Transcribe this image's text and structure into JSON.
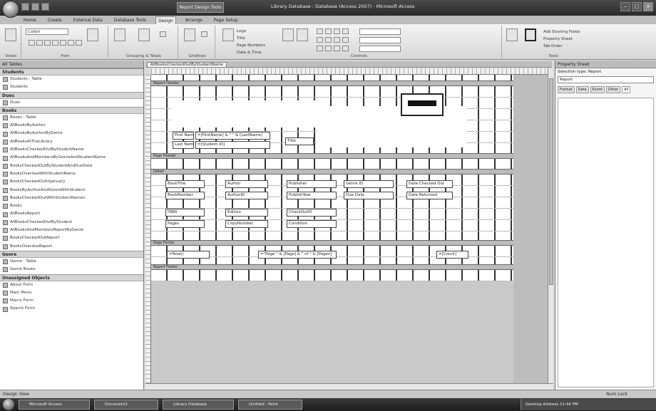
{
  "titlebar": {
    "tool_tab": "Report Design Tools",
    "window_title": "Library Database : Database (Access 2007) - Microsoft Access"
  },
  "ribbon_tabs": [
    "Home",
    "Create",
    "External Data",
    "Database Tools",
    "Design",
    "Arrange",
    "Page Setup"
  ],
  "ribbon": {
    "group_labels": [
      "Views",
      "Font",
      "Grouping & Totals",
      "Gridlines",
      "Controls",
      "Tools"
    ],
    "font_name": "Calibri",
    "controls_text": [
      "Logo",
      "Title",
      "Page Numbers",
      "Date & Time"
    ],
    "tools_text": [
      "Add Existing Fields",
      "Property Sheet",
      "Tab Order"
    ]
  },
  "nav": {
    "header": "All Tables",
    "sections": [
      {
        "title": "Students",
        "items": [
          "Students : Table",
          "Students"
        ]
      },
      {
        "title": "Dues",
        "items": [
          "Dues"
        ]
      },
      {
        "title": "Books",
        "items": [
          "Books : Table",
          "AllBooksByAuthor",
          "AllBooksByAuthorByGenre",
          "AllBooksAtTheLibrary",
          "AllBooksCheckedOutByStudentName",
          "AllBooksAndMembersByGenreAndStudentName",
          "BooksCheckedOutByStudentAndDueDate",
          "BooksOverdueWithStudentName",
          "BooksCheckedOutInJanuary",
          "BooksByAuthorAndGenreWithStudent",
          "BooksCheckedOutWithStudentNames",
          "Books",
          "AllBooksReport",
          "AllBooksCheckedOutByStudent",
          "AllBooksAndMembersReportByGenre",
          "BooksCheckedOutReport",
          "BooksOverdueReport"
        ]
      },
      {
        "title": "Genre",
        "items": [
          "Genre : Table",
          "Genre Books"
        ]
      },
      {
        "title": "Unassigned Objects",
        "items": [
          "About Form",
          "Main Menu",
          "Macro Form",
          "Search Form"
        ]
      }
    ]
  },
  "doc": {
    "tab_label": "AllBooksCheckedOutByStudentName",
    "sections": [
      "Report Header",
      "Page Header",
      "Detail",
      "Page Footer",
      "Report Footer"
    ],
    "header_controls": [
      "First Name",
      "Last Name",
      "=[FirstName] & \" \" & [LastName]",
      "=[Student ID]",
      "Title"
    ],
    "detail_controls": [
      "BookTitle",
      "Author",
      "Publisher",
      "Genre ID",
      "Date Checked Out",
      "BookNumber",
      "AuthorID",
      "PublishYear",
      "Due Date",
      "Date Returned",
      "ISBN",
      "Edition",
      "CheckOutID",
      "Pages",
      "CopyNumber",
      "Condition"
    ],
    "footer_controls": [
      "=Now()",
      "=\"Page \" & [Page] & \" of \" & [Pages]",
      "=[Count]"
    ]
  },
  "props": {
    "header": "Property Sheet",
    "selection_type": "Selection type: Report",
    "dropdown_value": "Report",
    "tabs": [
      "Format",
      "Data",
      "Event",
      "Other",
      "All"
    ]
  },
  "status": {
    "left": "Design View",
    "right": "Num Lock"
  },
  "taskbar": {
    "buttons": [
      "Start",
      "Microsoft Access",
      "Document1",
      "Library Database",
      "Untitled - Paint"
    ],
    "tray": "Desktop  Address  11:44 PM"
  }
}
